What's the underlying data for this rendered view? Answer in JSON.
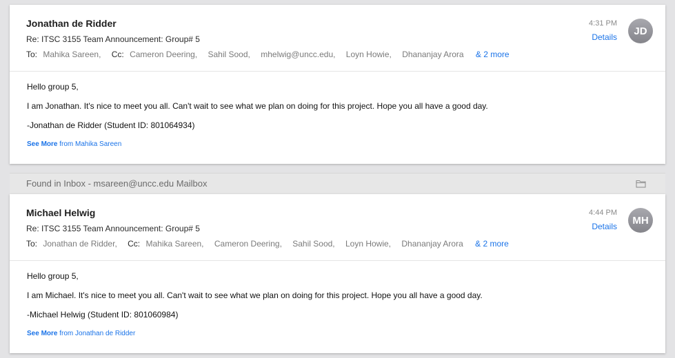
{
  "messages": [
    {
      "sender": "Jonathan de Ridder",
      "subject": "Re: ITSC 3155 Team Announcement: Group# 5",
      "to_label": "To:",
      "to": [
        "Mahika Sareen,"
      ],
      "cc_label": "Cc:",
      "cc": [
        "Cameron Deering,",
        "Sahil Sood,",
        "mhelwig@uncc.edu,",
        "Loyn Howie,",
        "Dhananjay Arora"
      ],
      "more": "& 2 more",
      "time": "4:31 PM",
      "details": "Details",
      "initials": "JD",
      "body": [
        "Hello group 5,",
        "I am Jonathan. It's nice to meet you all. Can't wait to see what we plan on doing for this project. Hope you all have a good day.",
        "-Jonathan de Ridder (Student ID: 801064934)"
      ],
      "see_more": "See More",
      "see_more_from": "from Mahika Sareen"
    },
    {
      "sender": "Michael Helwig",
      "subject": "Re: ITSC 3155 Team Announcement: Group# 5",
      "to_label": "To:",
      "to": [
        "Jonathan de Ridder,"
      ],
      "cc_label": "Cc:",
      "cc": [
        "Mahika Sareen,",
        "Cameron Deering,",
        "Sahil Sood,",
        "Loyn Howie,",
        "Dhananjay Arora"
      ],
      "more": "& 2 more",
      "time": "4:44 PM",
      "details": "Details",
      "initials": "MH",
      "body": [
        "Hello group 5,",
        "I am Michael. It's nice to meet you all. Can't wait to see what we plan on doing for this project. Hope you all have a good day.",
        "-Michael Helwig (Student ID: 801060984)"
      ],
      "see_more": "See More",
      "see_more_from": "from Jonathan de Ridder"
    }
  ],
  "found_bar": {
    "text": "Found in Inbox - msareen@uncc.edu Mailbox",
    "icon": "folder-icon"
  }
}
